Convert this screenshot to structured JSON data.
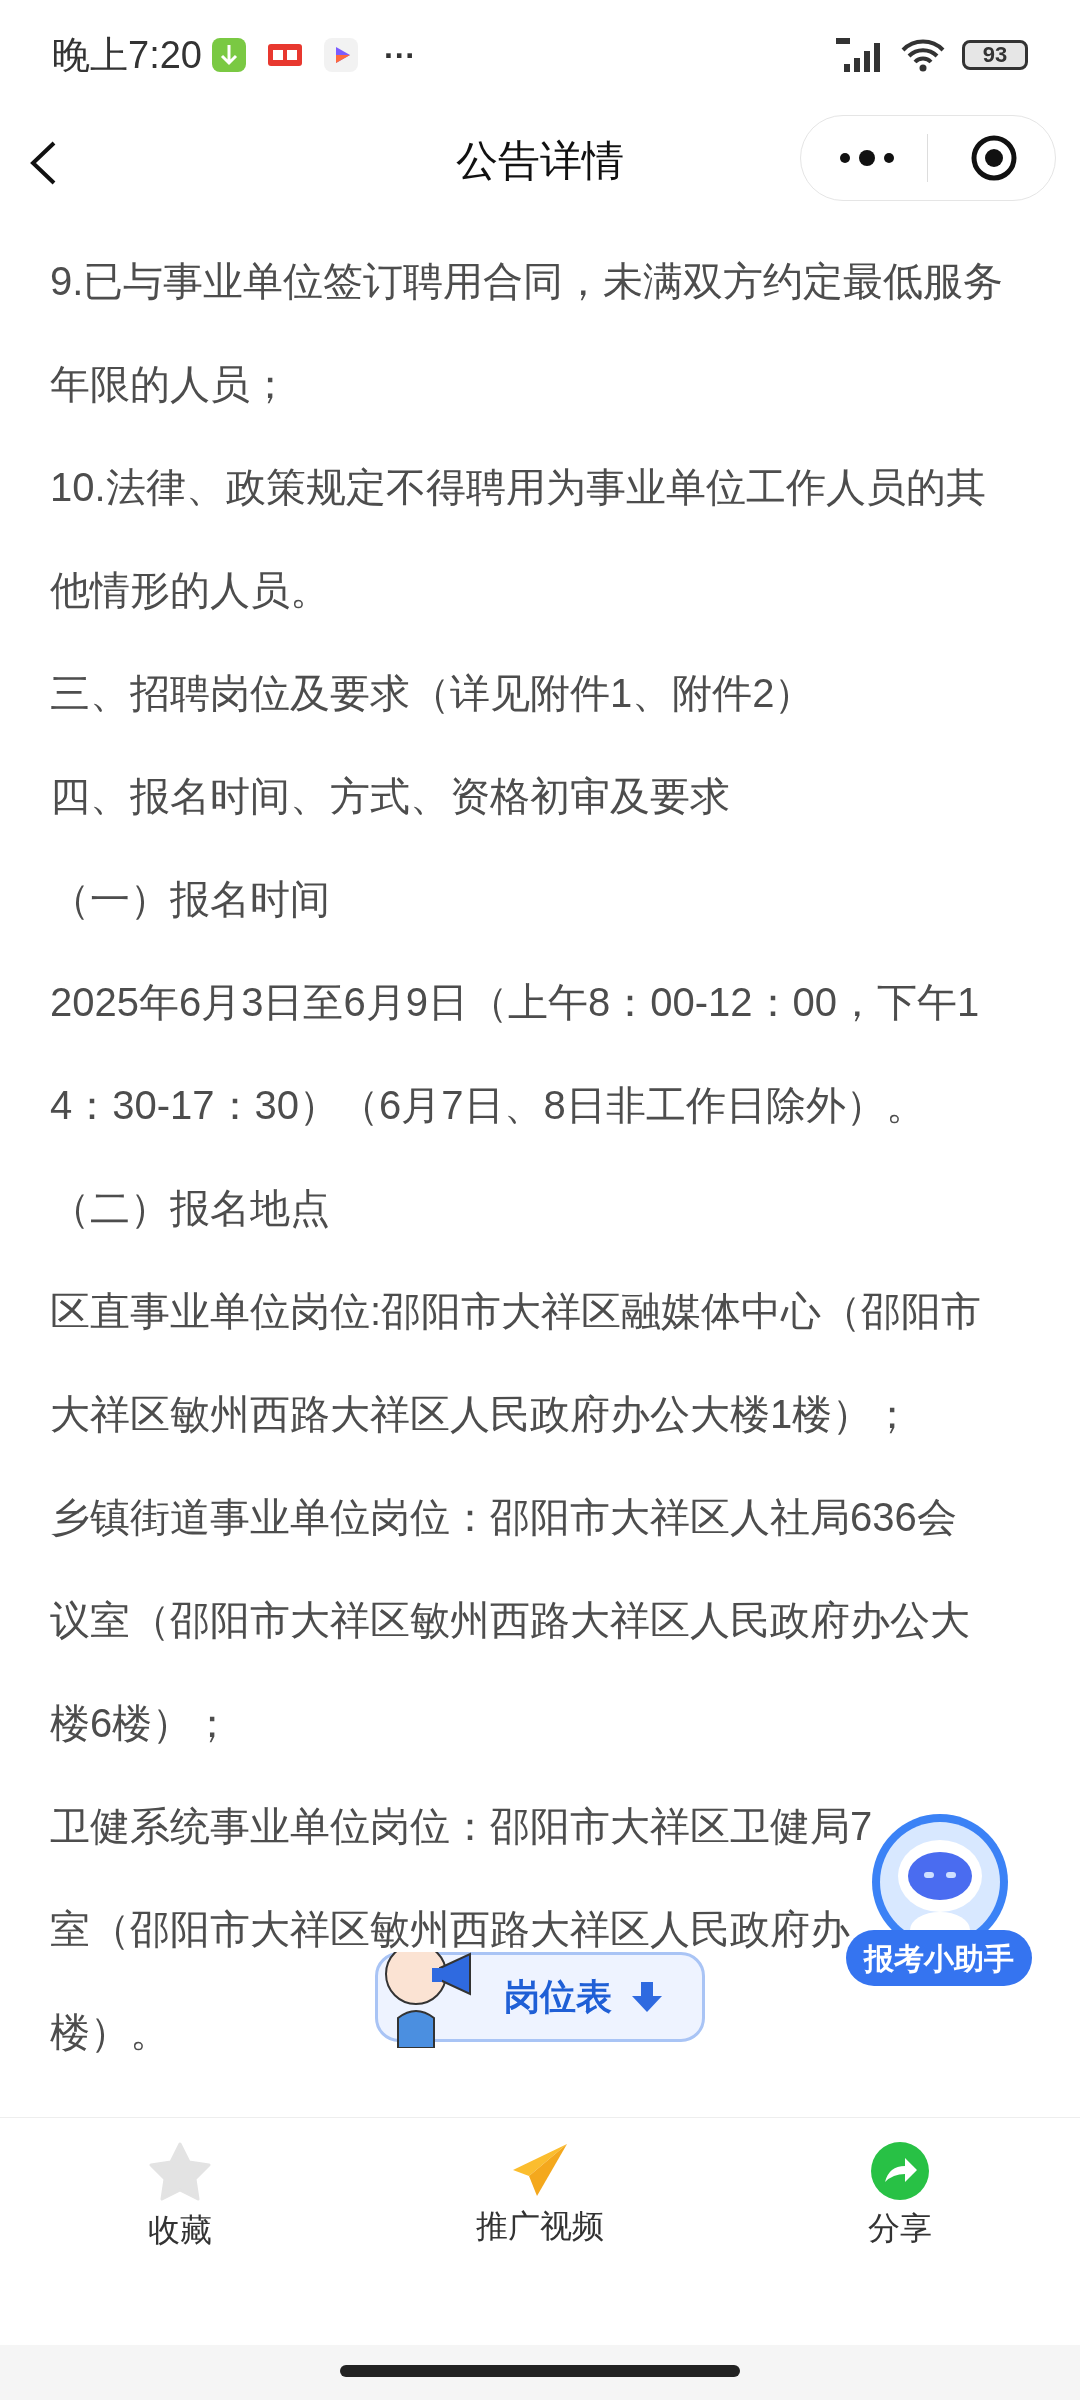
{
  "status_bar": {
    "time": "晚上7:20",
    "more": "···",
    "battery": "93"
  },
  "nav_bar": {
    "title": "公告详情"
  },
  "lines": [
    "9.已与事业单位签订聘用合同，未满双方约定最低服务",
    "年限的人员；",
    "10.法律、政策规定不得聘用为事业单位工作人员的其",
    "他情形的人员。",
    "三、招聘岗位及要求（详见附件1、附件2）",
    "四、报名时间、方式、资格初审及要求",
    "（一）报名时间",
    "2025年6月3日至6月9日（上午8：00-12：00，下午1",
    "4：30-17：30）（6月7日、8日非工作日除外）。",
    "（二）报名地点",
    "区直事业单位岗位:邵阳市大祥区融媒体中心（邵阳市",
    "大祥区敏州西路大祥区人民政府办公大楼1楼）；",
    "乡镇街道事业单位岗位：邵阳市大祥区人社局636会",
    "议室（邵阳市大祥区敏州西路大祥区人民政府办公大",
    "楼6楼）；",
    "卫健系统事业单位岗位：邵阳市大祥区卫健局7",
    "室（邵阳市大祥区敏州西路大祥区人民政府办",
    "楼）。"
  ],
  "floating": {
    "positions_button": "岗位表",
    "assistant_label": "报考小助手"
  },
  "bottom_actions": [
    {
      "kind": "star",
      "label": "收藏"
    },
    {
      "kind": "plane",
      "label": "推广视频"
    },
    {
      "kind": "share",
      "label": "分享"
    }
  ]
}
